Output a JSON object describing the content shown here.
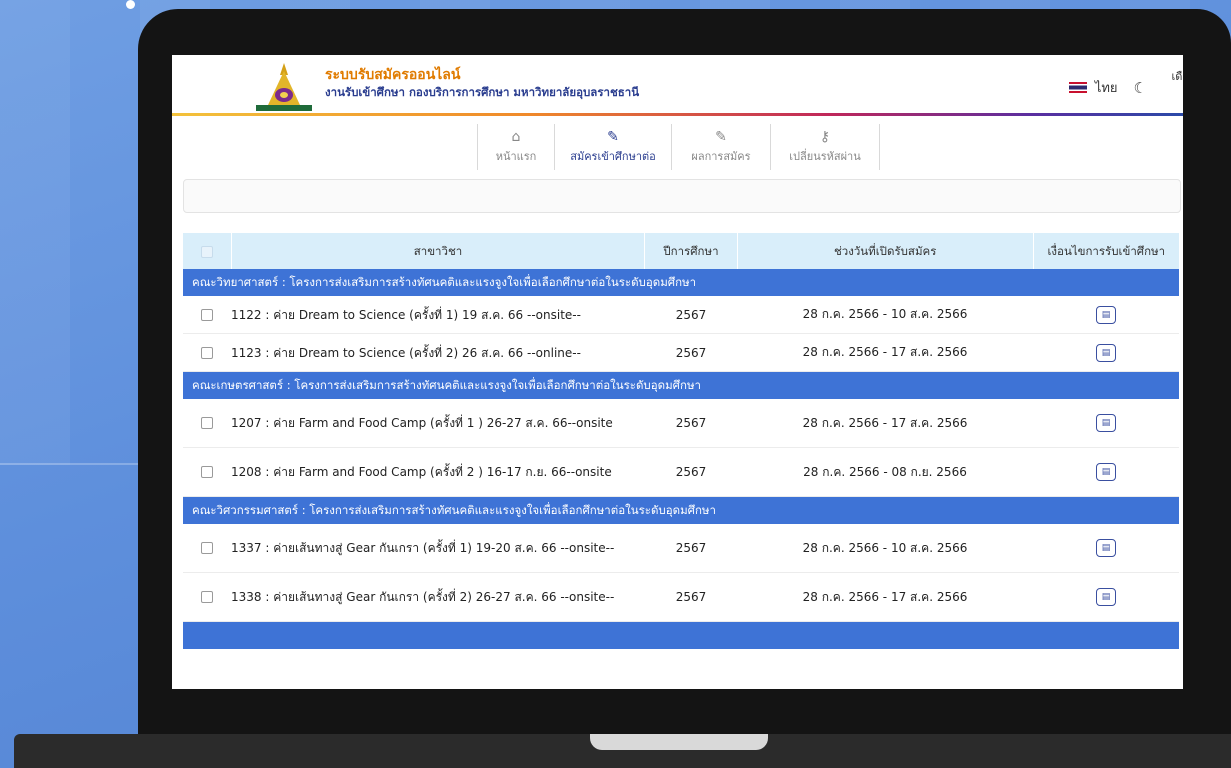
{
  "header": {
    "title": "ระบบรับสมัครออนไลน์",
    "subtitle": "งานรับเข้าศึกษา กองบริการการศึกษา มหาวิทยาลัยอุบลราชธานี",
    "language": "ไทย",
    "month_partial": "เดือ"
  },
  "nav": [
    {
      "label": "หน้าแรก",
      "icon": "home-icon"
    },
    {
      "label": "สมัครเข้าศึกษาต่อ",
      "icon": "edit-icon"
    },
    {
      "label": "ผลการสมัคร",
      "icon": "edit-icon"
    },
    {
      "label": "เปลี่ยนรหัสผ่าน",
      "icon": "key-icon"
    }
  ],
  "table": {
    "headers": {
      "name": "สาขาวิชา",
      "year": "ปีการศึกษา",
      "dates": "ช่วงวันที่เปิดรับสมัคร",
      "conditions": "เงื่อนไขการรับเข้าศึกษา"
    },
    "groups": [
      {
        "title": "คณะวิทยาศาสตร์ : โครงการส่งเสริมการสร้างทัศนคติและแรงจูงใจเพื่อเลือกศึกษาต่อในระดับอุดมศึกษา",
        "rows": [
          {
            "name": "1122 : ค่าย Dream to Science (ครั้งที่ 1) 19 ส.ค. 66 --onsite--",
            "year": "2567",
            "dates": "28 ก.ค. 2566 - 10 ส.ค. 2566"
          },
          {
            "name": "1123 : ค่าย Dream to Science (ครั้งที่ 2) 26 ส.ค. 66 --online--",
            "year": "2567",
            "dates": "28 ก.ค. 2566 - 17 ส.ค. 2566"
          }
        ]
      },
      {
        "title": "คณะเกษตรศาสตร์ : โครงการส่งเสริมการสร้างทัศนคติและแรงจูงใจเพื่อเลือกศึกษาต่อในระดับอุดมศึกษา",
        "rows": [
          {
            "name": "1207 : ค่าย Farm and Food Camp (ครั้งที่ 1 ) 26-27 ส.ค. 66--onsite",
            "year": "2567",
            "dates": "28 ก.ค. 2566 - 17 ส.ค. 2566"
          },
          {
            "name": "1208 : ค่าย Farm and Food Camp (ครั้งที่ 2 ) 16-17 ก.ย. 66--onsite",
            "year": "2567",
            "dates": "28 ก.ค. 2566 - 08 ก.ย. 2566"
          }
        ]
      },
      {
        "title": "คณะวิศวกรรมศาสตร์ : โครงการส่งเสริมการสร้างทัศนคติและแรงจูงใจเพื่อเลือกศึกษาต่อในระดับอุดมศึกษา",
        "rows": [
          {
            "name": "1337 : ค่ายเส้นทางสู่ Gear กันเกรา (ครั้งที่ 1) 19-20 ส.ค. 66 --onsite--",
            "year": "2567",
            "dates": "28 ก.ค. 2566 - 10 ส.ค. 2566"
          },
          {
            "name": "1338 : ค่ายเส้นทางสู่ Gear กันเกรา (ครั้งที่ 2) 26-27 ส.ค. 66 --onsite--",
            "year": "2567",
            "dates": "28 ก.ค. 2566 - 17 ส.ค. 2566"
          }
        ]
      }
    ]
  }
}
